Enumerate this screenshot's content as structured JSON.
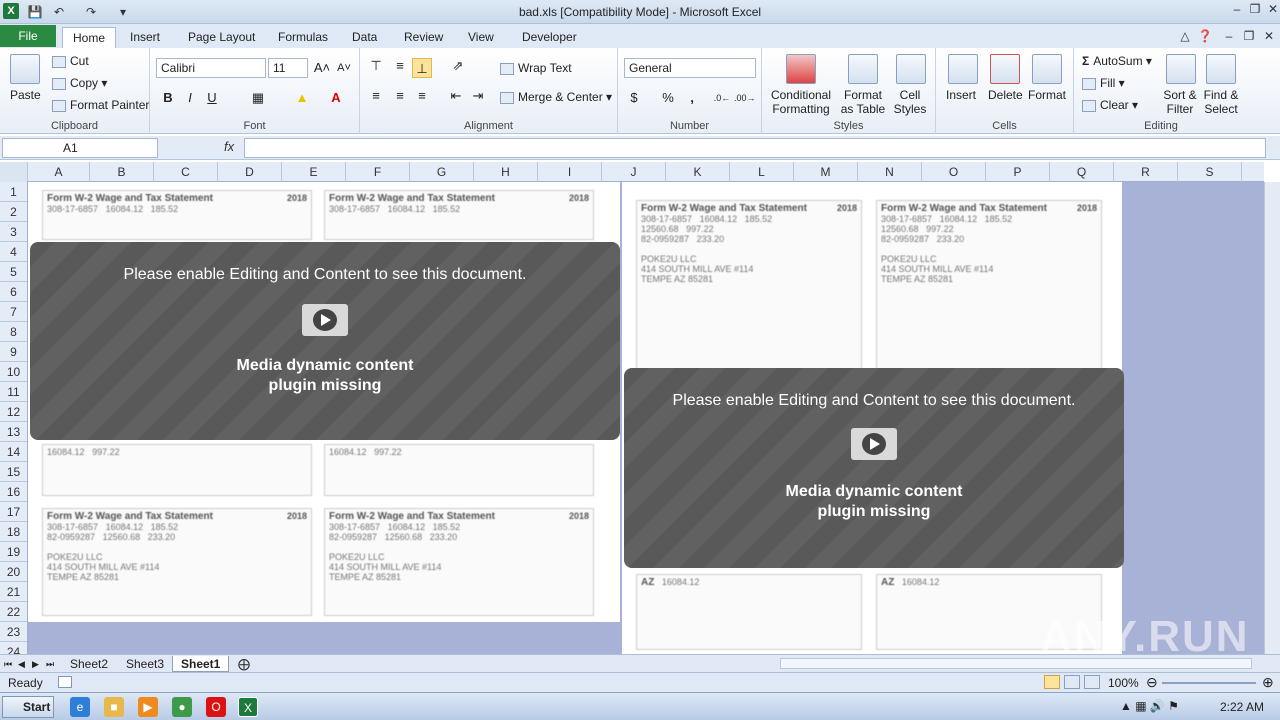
{
  "window": {
    "title": "bad.xls  [Compatibility Mode] - Microsoft Excel",
    "app_icon": "X",
    "quick_access": [
      "save-icon",
      "undo-icon",
      "redo-icon",
      "customize-icon"
    ]
  },
  "ribbon_tabs": [
    "File",
    "Home",
    "Insert",
    "Page Layout",
    "Formulas",
    "Data",
    "Review",
    "View",
    "Developer"
  ],
  "active_tab": "Home",
  "clipboard": {
    "paste": "Paste",
    "cut": "Cut",
    "copy": "Copy",
    "format_painter": "Format Painter",
    "label": "Clipboard"
  },
  "font": {
    "name": "Calibri",
    "size": "11",
    "bold": "B",
    "italic": "I",
    "underline": "U",
    "label": "Font"
  },
  "alignment": {
    "wrap": "Wrap Text",
    "merge": "Merge & Center",
    "label": "Alignment"
  },
  "number": {
    "format": "General",
    "currency": "$",
    "percent": "%",
    "comma": ",",
    "label": "Number"
  },
  "styles": {
    "conditional": "Conditional",
    "conditional2": "Formatting",
    "format_table": "Format",
    "format_table2": "as Table",
    "cell_styles": "Cell",
    "cell_styles2": "Styles",
    "label": "Styles"
  },
  "cells": {
    "insert": "Insert",
    "delete": "Delete",
    "format": "Format",
    "label": "Cells"
  },
  "editing": {
    "autosum": "AutoSum",
    "fill": "Fill",
    "clear": "Clear",
    "sort": "Sort &",
    "sort2": "Filter",
    "find": "Find &",
    "find2": "Select",
    "label": "Editing"
  },
  "formula_bar": {
    "name_box": "A1",
    "fx": "fx",
    "value": ""
  },
  "columns": [
    "A",
    "B",
    "C",
    "D",
    "E",
    "F",
    "G",
    "H",
    "I",
    "J",
    "K",
    "L",
    "M",
    "N",
    "O",
    "P",
    "Q",
    "R",
    "S"
  ],
  "rows": [
    "1",
    "2",
    "3",
    "4",
    "5",
    "6",
    "7",
    "8",
    "9",
    "10",
    "11",
    "12",
    "13",
    "14",
    "15",
    "16",
    "17",
    "18",
    "19",
    "20",
    "21",
    "22",
    "23",
    "24"
  ],
  "document": {
    "form_title": "Form W-2 Wage and Tax Statement",
    "year": "2018",
    "ssn": "308-17-6857",
    "ein": "82-0959287",
    "wages": "16084.12",
    "fed_tax": "185.52",
    "ss_wages": "12560.68",
    "ss_tax": "997.22",
    "medicare": "233.20",
    "employer": "POKE2U LLC",
    "address1": "414 SOUTH MILL AVE #114",
    "address2": "TEMPE AZ 85281",
    "state": "AZ"
  },
  "overlays": [
    {
      "message": "Please enable Editing and Content to see this document.",
      "line1": "Media dynamic content",
      "line2": "plugin missing"
    },
    {
      "message": "Please enable Editing and Content to see this document.",
      "line1": "Media dynamic content",
      "line2": "plugin missing"
    }
  ],
  "sheet_tabs": [
    "Sheet2",
    "Sheet3",
    "Sheet1"
  ],
  "active_sheet": "Sheet1",
  "status": {
    "ready": "Ready",
    "zoom": "100%"
  },
  "taskbar": {
    "start": "Start",
    "time": "2:22 AM"
  },
  "watermark": "ANY.RUN"
}
